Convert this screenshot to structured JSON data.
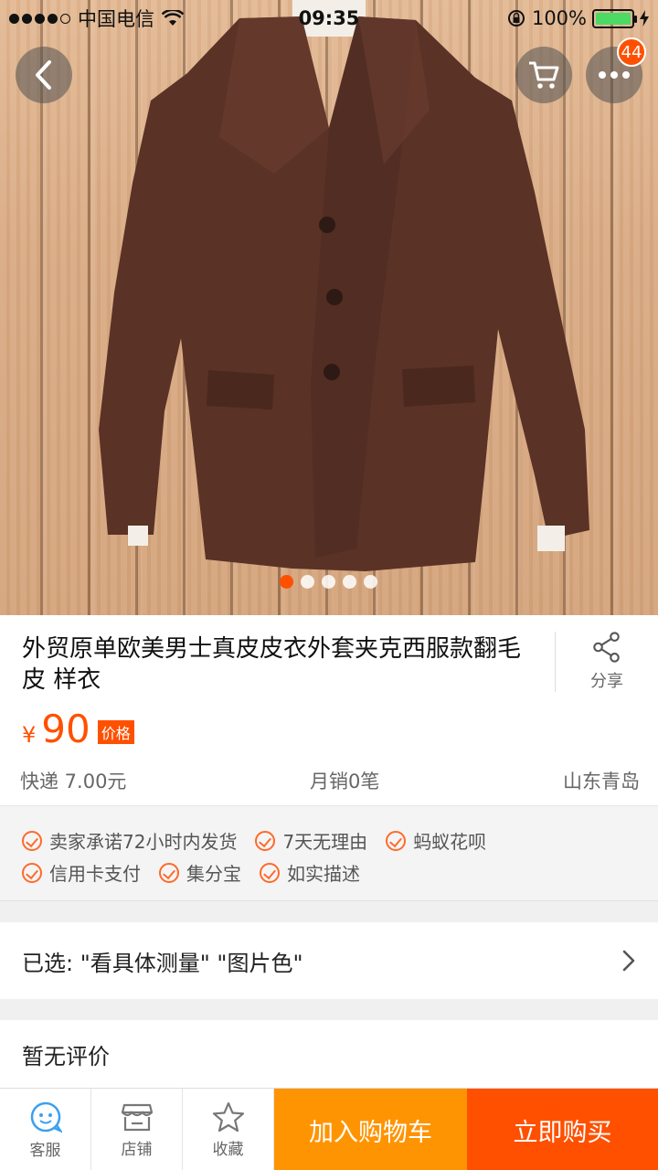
{
  "status_bar": {
    "carrier": "中国电信",
    "time": "09:35",
    "battery": "100%"
  },
  "nav": {
    "cart_badge": "44"
  },
  "product": {
    "title": "外贸原单欧美男士真皮皮衣外套夹克西服款翻毛皮  样衣",
    "share_label": "分享",
    "currency": "¥",
    "price": "90",
    "price_tag": "价格",
    "shipping": "快递 7.00元",
    "monthly_sales": "月销0笔",
    "location": "山东青岛"
  },
  "carousel": {
    "total": 5,
    "active_index": 0
  },
  "guarantees": [
    [
      "卖家承诺72小时内发货",
      "7天无理由",
      "蚂蚁花呗"
    ],
    [
      "信用卡支付",
      "集分宝",
      "如实描述"
    ]
  ],
  "selection": {
    "text": "已选: \"看具体测量\" \"图片色\""
  },
  "reviews": {
    "text": "暂无评价"
  },
  "bottom_bar": {
    "service_label": "客服",
    "shop_label": "店铺",
    "favorite_label": "收藏",
    "add_to_cart": "加入购物车",
    "buy_now": "立即购买"
  },
  "colors": {
    "accent": "#ff5000",
    "cart_button": "#ff9402",
    "jacket": "#5a3226"
  }
}
